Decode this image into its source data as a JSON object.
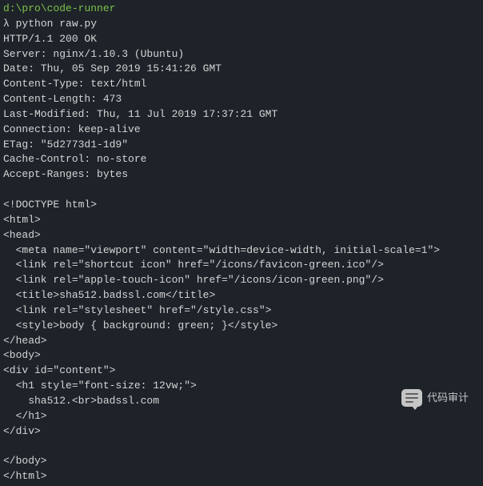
{
  "path": {
    "drive": "d:",
    "sep1": "\\",
    "dir1": "pro",
    "sep2": "\\",
    "dir2": "code-runner"
  },
  "prompt": "λ ",
  "command": "python raw.py",
  "lines": [
    "HTTP/1.1 200 OK",
    "Server: nginx/1.10.3 (Ubuntu)",
    "Date: Thu, 05 Sep 2019 15:41:26 GMT",
    "Content-Type: text/html",
    "Content-Length: 473",
    "Last-Modified: Thu, 11 Jul 2019 17:37:21 GMT",
    "Connection: keep-alive",
    "ETag: \"5d2773d1-1d9\"",
    "Cache-Control: no-store",
    "Accept-Ranges: bytes",
    "",
    "<!DOCTYPE html>",
    "<html>",
    "<head>",
    "  <meta name=\"viewport\" content=\"width=device-width, initial-scale=1\">",
    "  <link rel=\"shortcut icon\" href=\"/icons/favicon-green.ico\"/>",
    "  <link rel=\"apple-touch-icon\" href=\"/icons/icon-green.png\"/>",
    "  <title>sha512.badssl.com</title>",
    "  <link rel=\"stylesheet\" href=\"/style.css\">",
    "  <style>body { background: green; }</style>",
    "</head>",
    "<body>",
    "<div id=\"content\">",
    "  <h1 style=\"font-size: 12vw;\">",
    "    sha512.<br>badssl.com",
    "  </h1>",
    "</div>",
    "",
    "</body>",
    "</html>"
  ],
  "watermark": "代码审计"
}
